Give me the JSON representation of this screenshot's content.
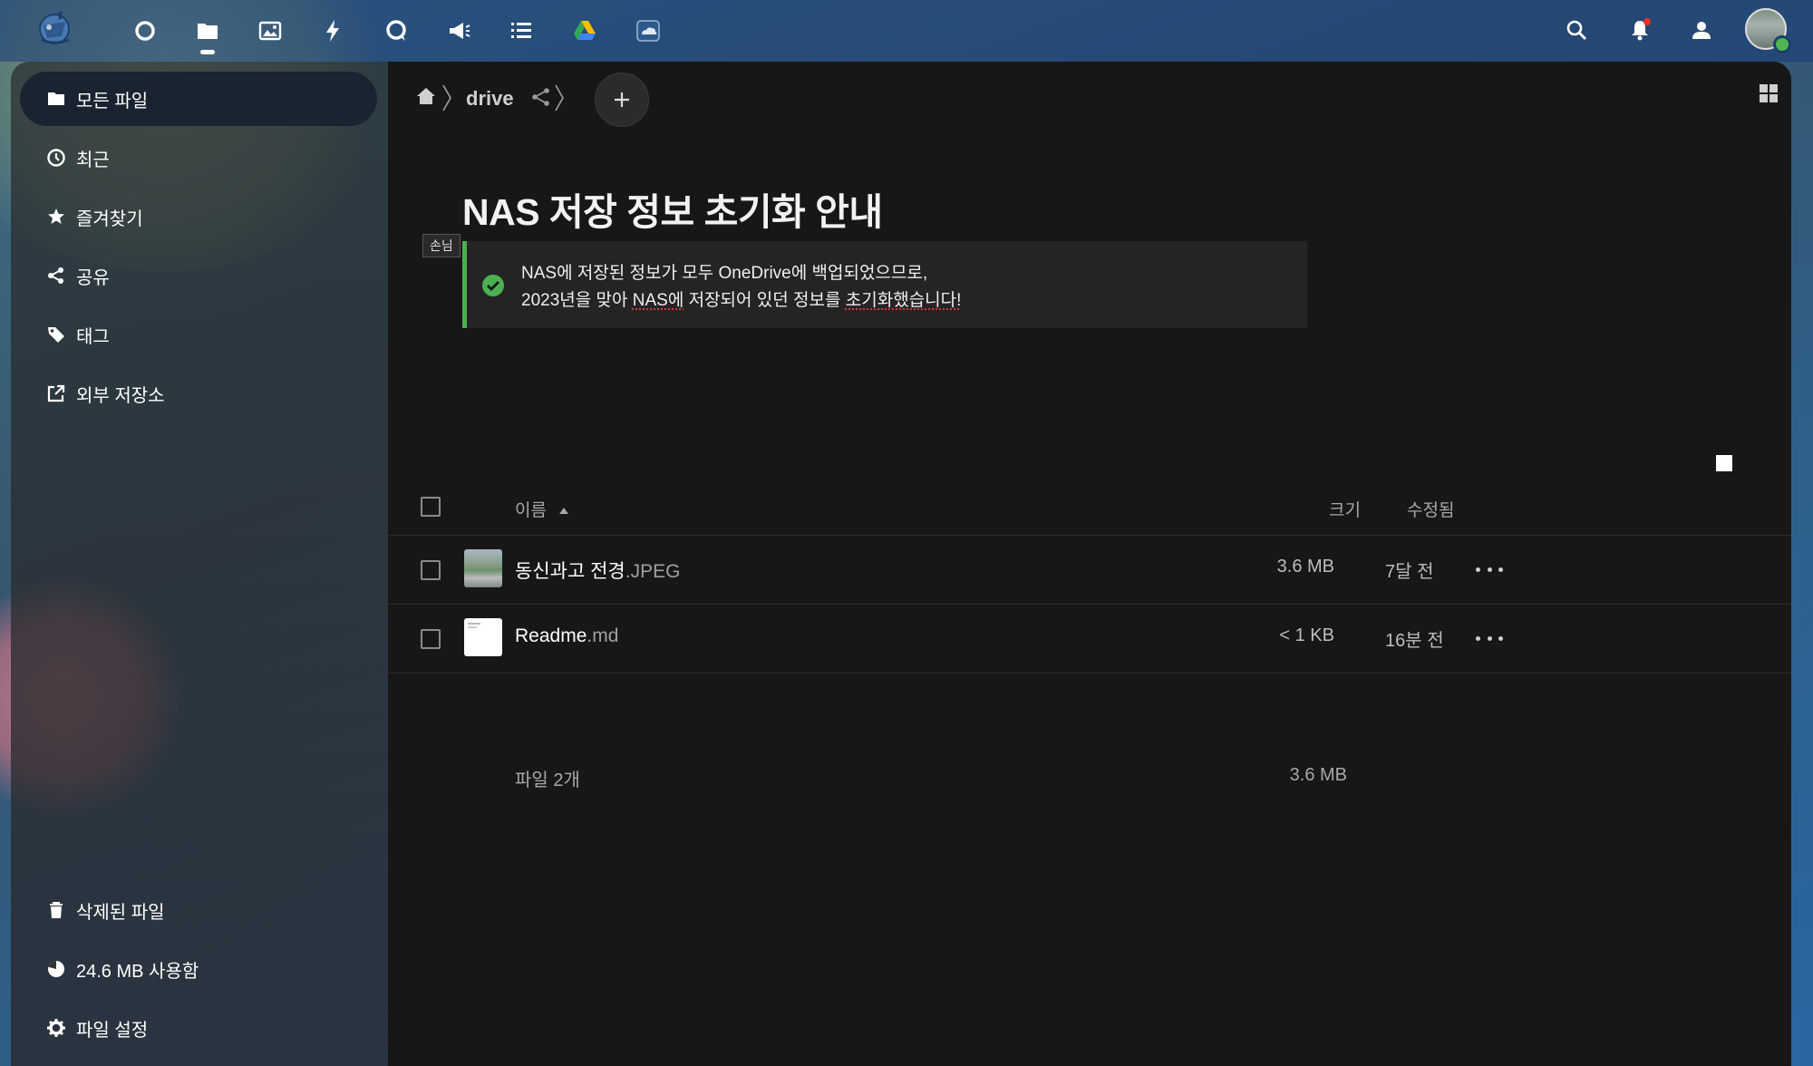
{
  "header": {
    "apps": [
      {
        "name": "dashboard-app-icon",
        "label": "Dashboard"
      },
      {
        "name": "files-app-icon",
        "label": "Files"
      },
      {
        "name": "photos-app-icon",
        "label": "Photos"
      },
      {
        "name": "activity-app-icon",
        "label": "Activity"
      },
      {
        "name": "talk-app-icon",
        "label": "Talk"
      },
      {
        "name": "announcements-app-icon",
        "label": "Announcements"
      },
      {
        "name": "tasks-app-icon",
        "label": "Tasks"
      },
      {
        "name": "google-drive-app-icon",
        "label": "Google Drive"
      },
      {
        "name": "onedrive-app-icon",
        "label": "OneDrive"
      }
    ],
    "active_app": "files-app-icon"
  },
  "sidebar": {
    "items": [
      {
        "label": "모든 파일",
        "icon": "folder-icon"
      },
      {
        "label": "최근",
        "icon": "clock-icon"
      },
      {
        "label": "즐겨찾기",
        "icon": "star-icon"
      },
      {
        "label": "공유",
        "icon": "share-icon"
      },
      {
        "label": "태그",
        "icon": "tag-icon"
      },
      {
        "label": "외부 저장소",
        "icon": "external-storage-icon"
      }
    ],
    "bottom": {
      "trash_label": "삭제된 파일",
      "quota_label": "24.6 MB 사용함",
      "settings_label": "파일 설정"
    }
  },
  "breadcrumb": {
    "folder": "drive"
  },
  "readme": {
    "title": "NAS 저장 정보 초기화 안내",
    "guest_tag": "손님",
    "line1": "NAS에 저장된 정보가 모두 OneDrive에 백업되었으므로,",
    "line2_prefix": "2023년을 맞아 ",
    "line2_nas": "NAS에",
    "line2_mid": " 저장되어 있던 정보를 ",
    "line2_spell": "초기화했습니다!",
    "accent_color": "#4bb04f"
  },
  "table": {
    "col_name": "이름",
    "col_size": "크기",
    "col_modified": "수정됨",
    "files": [
      {
        "base": "동신과고 전경",
        "ext": ".JPEG",
        "size": "3.6 MB",
        "modified": "7달 전",
        "thumb": "photo"
      },
      {
        "base": "Readme",
        "ext": ".md",
        "size": "< 1 KB",
        "modified": "16분 전",
        "thumb": "doc"
      }
    ],
    "summary_count": "파일 2개",
    "summary_size": "3.6 MB"
  }
}
